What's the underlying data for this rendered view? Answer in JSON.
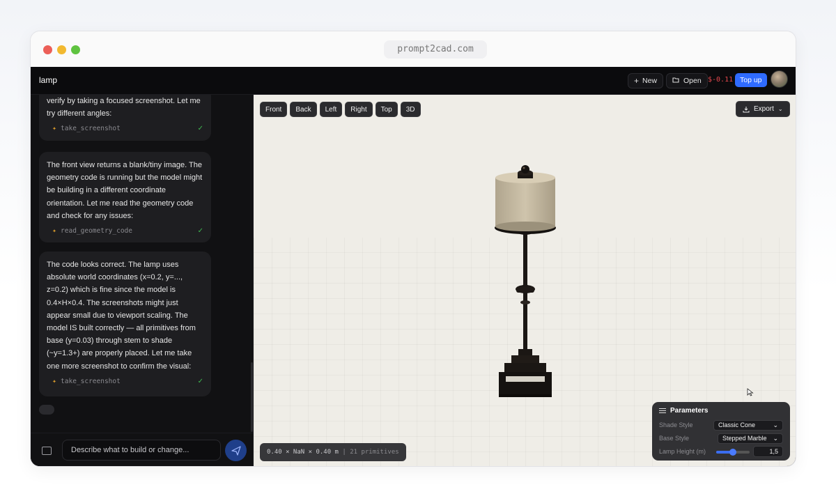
{
  "browser": {
    "url": "prompt2cad.com"
  },
  "topbar": {
    "title": "lamp",
    "new_label": "New",
    "open_label": "Open",
    "balance": "$-0.11",
    "topup_label": "Top up"
  },
  "chat": {
    "messages": [
      {
        "text": "verify by taking a focused screenshot. Let me try different angles:",
        "tool": "take_screenshot"
      },
      {
        "text": "The front view returns a blank/tiny image. The geometry code is running but the model might be building in a different coordinate orientation. Let me read the geometry code and check for any issues:",
        "tool": "read_geometry_code"
      },
      {
        "text": "The code looks correct. The lamp uses absolute world coordinates (x=0.2, y=..., z=0.2) which is fine since the model is 0.4×H×0.4. The screenshots might just appear small due to viewport scaling. The model IS built correctly — all primitives from base (y=0.03) through stem to shade (~y=1.3+) are properly placed. Let me take one more screenshot to confirm the visual:",
        "tool": "take_screenshot"
      }
    ],
    "composer_placeholder": "Describe what to build or change..."
  },
  "viewport": {
    "views": [
      "Front",
      "Back",
      "Left",
      "Right",
      "Top",
      "3D"
    ],
    "export_label": "Export",
    "dimensions": "0.40 × NaN × 0.40 m",
    "primitives": "| 21 primitives",
    "colors": {
      "background": "#efede7",
      "shade": "#c8bda6",
      "metal": "#1b1714"
    }
  },
  "parameters": {
    "title": "Parameters",
    "shade_style": {
      "label": "Shade Style",
      "value": "Classic Cone"
    },
    "base_style": {
      "label": "Base Style",
      "value": "Stepped Marble"
    },
    "lamp_height": {
      "label": "Lamp Height (m)",
      "value": "1,5",
      "fraction": 0.5
    }
  },
  "accent": "#2f6bff"
}
